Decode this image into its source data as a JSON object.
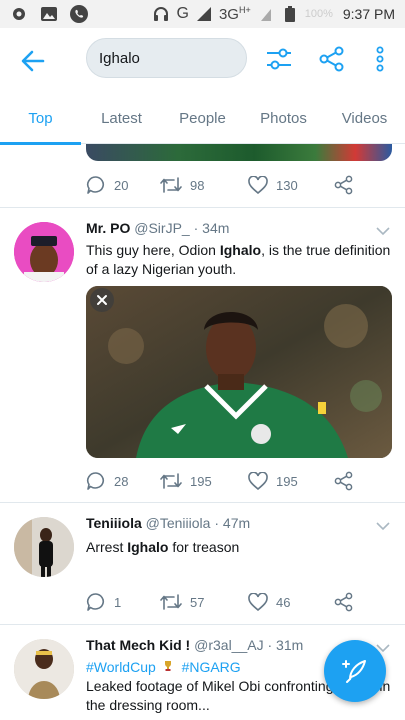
{
  "status_bar": {
    "network": "G",
    "signal_type": "3G",
    "hplus": "H+",
    "battery": "100%",
    "time": "9:37 PM"
  },
  "search": {
    "query": "Ighalo"
  },
  "tabs": [
    {
      "label": "Top",
      "active": true
    },
    {
      "label": "Latest",
      "active": false
    },
    {
      "label": "People",
      "active": false
    },
    {
      "label": "Photos",
      "active": false
    },
    {
      "label": "Videos",
      "active": false
    }
  ],
  "tweets": [
    {
      "replies": "20",
      "retweets": "98",
      "likes": "130"
    },
    {
      "name": "Mr. PO",
      "handle": "@SirJP_",
      "time": "34m",
      "text_parts": [
        "This guy here, Odion ",
        "Ighalo",
        ", is the true definition of a lazy Nigerian youth."
      ],
      "replies": "28",
      "retweets": "195",
      "likes": "195"
    },
    {
      "name": "Teniiiola",
      "handle": "@Teniiiola",
      "time": "47m",
      "text_parts": [
        "Arrest ",
        "Ighalo",
        " for treason"
      ],
      "replies": "1",
      "retweets": "57",
      "likes": "46"
    },
    {
      "name": "That Mech Kid !",
      "handle": "@r3al__AJ",
      "time": "31m",
      "hashtags": [
        "#WorldCup",
        "#NGARG"
      ],
      "text": "Leaked footage of Mikel Obi  confronting Ighalo in the dressing room..."
    }
  ],
  "icons": {
    "back": "arrow-left-icon",
    "filter": "sliders-icon",
    "share": "share-icon",
    "more": "more-vertical-icon",
    "compose": "compose-tweet-icon"
  },
  "colors": {
    "accent": "#1da1f2",
    "text": "#14171a",
    "muted": "#657786",
    "search_bg": "#e6ecf0"
  }
}
